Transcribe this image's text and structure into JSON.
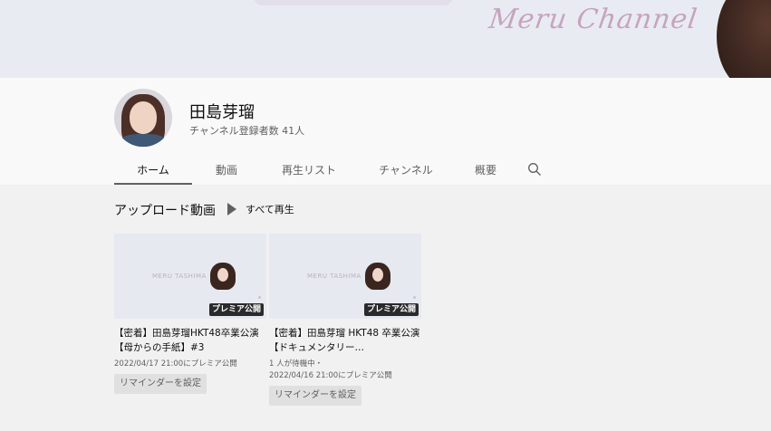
{
  "banner": {
    "script_text": "Meru Channel"
  },
  "channel": {
    "name": "田島芽瑠",
    "subscribers": "チャンネル登録者数 41人"
  },
  "tabs": [
    {
      "label": "ホーム",
      "active": true
    },
    {
      "label": "動画",
      "active": false
    },
    {
      "label": "再生リスト",
      "active": false
    },
    {
      "label": "チャンネル",
      "active": false
    },
    {
      "label": "概要",
      "active": false
    }
  ],
  "section": {
    "title": "アップロード動画",
    "play_all": "すべて再生"
  },
  "videos": [
    {
      "thumb_brand": "MERU TASHIMA",
      "badge": "プレミア公開",
      "title": "【密着】田島芽瑠HKT48卒業公演 【母からの手紙】#3",
      "meta_line1": "2022/04/17 21:00にプレミア公開",
      "meta_line2": "",
      "reminder": "リマインダーを設定"
    },
    {
      "thumb_brand": "MERU TASHIMA",
      "badge": "プレミア公開",
      "title": "【密着】田島芽瑠 HKT48 卒業公演 【ドキュメンタリー…",
      "meta_line1": "1 人が待機中・",
      "meta_line2": "2022/04/16 21:00にプレミア公開",
      "reminder": "リマインダーを設定"
    }
  ],
  "colors": {
    "tab_underline": "#606060",
    "badge_bg": "#000000",
    "page_bg": "#f1f1f1"
  },
  "icons": {
    "search": "search-icon",
    "play": "play-icon"
  }
}
